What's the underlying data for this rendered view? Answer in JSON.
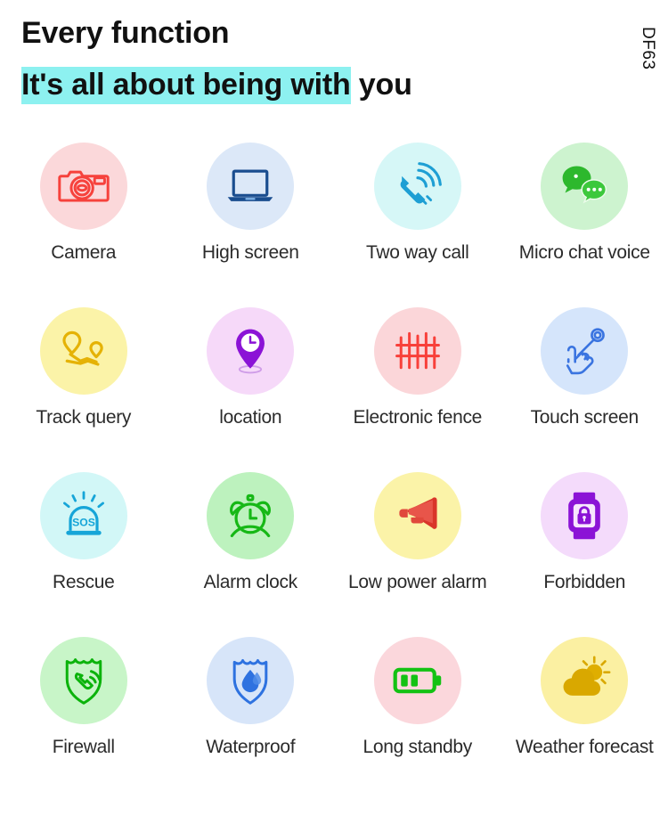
{
  "header": {
    "title_line_1": "Every function",
    "title_line_2_highlight": "It's all about being with",
    "title_line_2_rest": " you",
    "highlight_color": "#8df1f0",
    "model_code": "DF63"
  },
  "features": [
    {
      "label": "Camera",
      "icon": "camera-icon",
      "circle_color": "#fbd8da",
      "icon_color": "#f6423c"
    },
    {
      "label": "High screen",
      "icon": "laptop-icon",
      "circle_color": "#dce8f8",
      "icon_color": "#1a4d8f"
    },
    {
      "label": "Two way call",
      "icon": "phone-call-icon",
      "circle_color": "#d6f7f7",
      "icon_color": "#1e9fd4"
    },
    {
      "label": "Micro chat voice",
      "icon": "chat-bubbles-icon",
      "circle_color": "#cdf3cf",
      "icon_color": "#2db82d"
    },
    {
      "label": "Track query",
      "icon": "route-pins-icon",
      "circle_color": "#fbf3a8",
      "icon_color": "#e5b205"
    },
    {
      "label": "location",
      "icon": "map-pin-clock-icon",
      "circle_color": "#f6d9f9",
      "icon_color": "#8b13d6"
    },
    {
      "label": "Electronic fence",
      "icon": "fence-icon",
      "circle_color": "#fbd6d9",
      "icon_color": "#f8403a"
    },
    {
      "label": "Touch screen",
      "icon": "touch-hand-icon",
      "circle_color": "#d5e5fb",
      "icon_color": "#3a74e0"
    },
    {
      "label": "Rescue",
      "icon": "sos-beacon-icon",
      "circle_color": "#d2f7f7",
      "icon_color": "#16a5d8"
    },
    {
      "label": "Alarm clock",
      "icon": "alarm-clock-icon",
      "circle_color": "#bdf2be",
      "icon_color": "#16b816"
    },
    {
      "label": "Low power alarm",
      "icon": "megaphone-icon",
      "circle_color": "#fbf3a8",
      "icon_color": "#e03225"
    },
    {
      "label": "Forbidden",
      "icon": "watch-lock-icon",
      "circle_color": "#f4dbfb",
      "icon_color": "#8b13d6"
    },
    {
      "label": "Firewall",
      "icon": "shield-phone-icon",
      "circle_color": "#c8f5c8",
      "icon_color": "#0bb30b"
    },
    {
      "label": "Waterproof",
      "icon": "shield-droplet-icon",
      "circle_color": "#d7e5f9",
      "icon_color": "#2e72e0"
    },
    {
      "label": "Long standby",
      "icon": "battery-icon",
      "circle_color": "#fbd7dc",
      "icon_color": "#13c213"
    },
    {
      "label": "Weather forecast",
      "icon": "sun-cloud-icon",
      "circle_color": "#fbf0a2",
      "icon_color": "#d9a800"
    }
  ]
}
